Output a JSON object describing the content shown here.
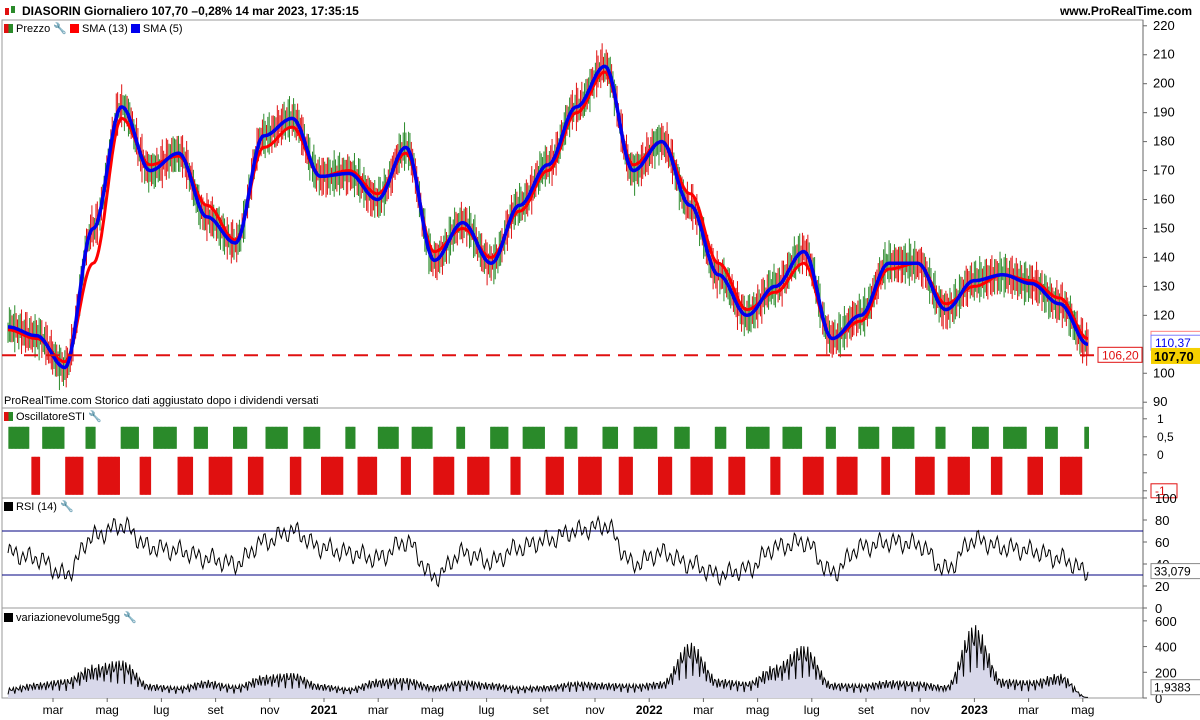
{
  "header": {
    "title": "DIASORIN Giornaliero 107,70 –0,28% 14 mar 2023, 17:35:15",
    "site": "www.ProRealTime.com"
  },
  "legend": {
    "price": "Prezzo",
    "sma13": "SMA (13)",
    "sma5": "SMA (5)",
    "sti": "OscillatoreSTI",
    "rsi": "RSI (14)",
    "vol": "variazionevolume5gg"
  },
  "footer_note": "ProRealTime.com  Storico dati aggiustato dopo i dividendi versati",
  "price_axis_ticks": [
    "220",
    "210",
    "200",
    "190",
    "180",
    "170",
    "160",
    "150",
    "140",
    "130",
    "120",
    "100",
    "90"
  ],
  "price_markers": {
    "sma13": "111,72",
    "sma5": "110,37",
    "support": "106,20",
    "last": "107,70"
  },
  "sti_ticks": [
    "1",
    "0,5",
    "0",
    "-0,5",
    "-1"
  ],
  "rsi_ticks": [
    "100",
    "80",
    "60",
    "40",
    "20",
    "0"
  ],
  "rsi_value": "33,079",
  "vol_ticks": [
    "600",
    "400",
    "200",
    "0"
  ],
  "vol_value": "1,9383",
  "x_labels": [
    "mar",
    "mag",
    "lug",
    "set",
    "nov",
    "2021",
    "mar",
    "mag",
    "lug",
    "set",
    "nov",
    "2022",
    "mar",
    "mag",
    "lug",
    "set",
    "nov",
    "2023",
    "mar",
    "mag"
  ],
  "colors": {
    "up": "#2a8a2a",
    "down": "#e01010",
    "sma13": "#ff0000",
    "sma5": "#0000ee",
    "support": "#e01010",
    "last_bg": "#f5d000"
  },
  "chart_data": {
    "type": "line",
    "title": "DIASORIN Giornaliero",
    "price_ylim": [
      88,
      222
    ],
    "support_level": 106.2,
    "x": [
      "2020-01",
      "2020-02",
      "2020-03",
      "2020-04",
      "2020-05",
      "2020-06",
      "2020-07",
      "2020-08",
      "2020-09",
      "2020-10",
      "2020-11",
      "2020-12",
      "2021-01",
      "2021-02",
      "2021-03",
      "2021-04",
      "2021-05",
      "2021-06",
      "2021-07",
      "2021-08",
      "2021-09",
      "2021-10",
      "2021-11",
      "2021-12",
      "2022-01",
      "2022-02",
      "2022-03",
      "2022-04",
      "2022-05",
      "2022-06",
      "2022-07",
      "2022-08",
      "2022-09",
      "2022-10",
      "2022-11",
      "2022-12",
      "2023-01",
      "2023-02",
      "2023-03"
    ],
    "series": [
      {
        "name": "SMA (13)",
        "values": [
          115,
          112,
          104,
          138,
          188,
          172,
          175,
          158,
          146,
          178,
          185,
          168,
          170,
          162,
          176,
          142,
          150,
          140,
          156,
          170,
          190,
          204,
          172,
          180,
          162,
          138,
          122,
          128,
          138,
          112,
          118,
          136,
          138,
          124,
          130,
          134,
          132,
          126,
          112
        ]
      },
      {
        "name": "SMA (5)",
        "values": [
          116,
          113,
          102,
          150,
          192,
          170,
          176,
          154,
          145,
          182,
          188,
          168,
          169,
          160,
          178,
          139,
          152,
          138,
          158,
          172,
          192,
          206,
          170,
          180,
          158,
          134,
          120,
          130,
          142,
          112,
          120,
          138,
          138,
          122,
          132,
          134,
          131,
          124,
          110
        ]
      }
    ],
    "rsi_ylim": [
      0,
      100
    ],
    "rsi_bands": [
      30,
      70
    ],
    "rsi": [
      50,
      45,
      30,
      65,
      75,
      55,
      52,
      45,
      40,
      60,
      70,
      55,
      50,
      45,
      60,
      28,
      50,
      42,
      55,
      62,
      70,
      75,
      40,
      50,
      40,
      30,
      35,
      55,
      60,
      32,
      55,
      60,
      58,
      35,
      62,
      55,
      52,
      45,
      33.079
    ],
    "volume_ylim": [
      0,
      700
    ],
    "volume": [
      80,
      120,
      150,
      260,
      300,
      110,
      90,
      140,
      100,
      180,
      200,
      110,
      80,
      150,
      160,
      100,
      140,
      120,
      90,
      100,
      130,
      120,
      110,
      130,
      440,
      150,
      130,
      260,
      420,
      120,
      110,
      140,
      130,
      100,
      580,
      150,
      140,
      190,
      1.9383
    ]
  }
}
